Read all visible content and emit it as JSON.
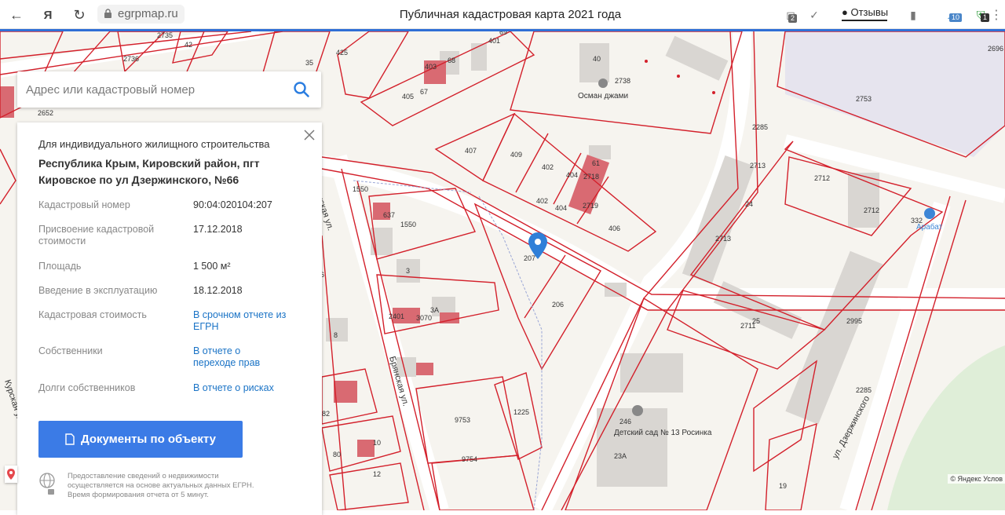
{
  "browser": {
    "url": "egrpmap.ru",
    "page_title": "Публичная кадастровая карта 2021 года",
    "feedback_label": "Отзывы",
    "badge_left": "2",
    "badge_cloud": "10",
    "badge_ext": "1"
  },
  "search": {
    "placeholder": "Адрес или кадастровый номер"
  },
  "info": {
    "purpose": "Для индивидуального жилищного строительства",
    "address": "Республика Крым, Кировский район, пгт Кировское по ул Дзержинского, №66",
    "rows": [
      {
        "label": "Кадастровый номер",
        "value": "90:04:020104:207"
      },
      {
        "label": "Присвоение кадастровой стоимости",
        "value": "17.12.2018"
      },
      {
        "label": "Площадь",
        "value": "1 500 м²"
      },
      {
        "label": "Введение в эксплуатацию",
        "value": "18.12.2018"
      },
      {
        "label": "Кадастровая стоимость",
        "value": "В срочном отчете из ЕГРН"
      },
      {
        "label": "Собственники",
        "value": "В отчете о переходе прав"
      },
      {
        "label": "Долги собственников",
        "value": "В отчете о рисках"
      }
    ],
    "docs_button": "Документы по объекту",
    "note": "Предоставление сведений о недвижимости осуществляется на основе актуальных данных ЕГРН. Время формирования отчета от 5 минут."
  },
  "map": {
    "streets": [
      "Брянская ул.",
      "Брянская ул.",
      "Курская ул.",
      "ул. Дзержинского"
    ],
    "places": [
      "Осман джами",
      "Арабат",
      "Детский сад № 13 Росинка"
    ],
    "parcels": [
      "2735",
      "2736",
      "42",
      "35",
      "425",
      "401",
      "69",
      "403",
      "68",
      "405",
      "67",
      "40",
      "2738",
      "2753",
      "2696",
      "2652",
      "407",
      "409",
      "402",
      "404",
      "2718",
      "61",
      "402",
      "404",
      "2719",
      "406",
      "207",
      "206",
      "1550",
      "1550",
      "637",
      "3",
      "2401",
      "3070",
      "3А",
      "8",
      "2713",
      "2712",
      "2712",
      "24",
      "2713",
      "332",
      "2995",
      "2711",
      "25",
      "246",
      "23А",
      "9753",
      "9754",
      "1225",
      "80",
      "10",
      "12",
      "19",
      "2285",
      "2285",
      "6",
      "82"
    ],
    "copyright": "© Яндекс Услов"
  }
}
